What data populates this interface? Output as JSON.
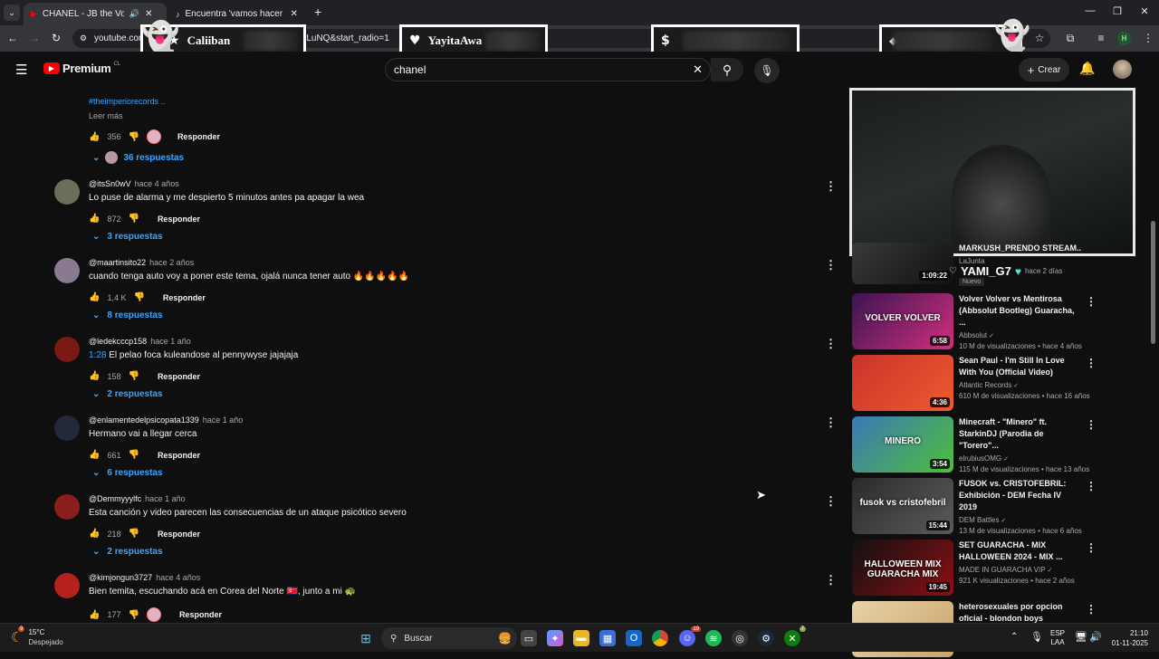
{
  "browser": {
    "tabs": [
      {
        "title": "CHANEL - JB the Voice | Vi"
      },
      {
        "title": "Encuentra 'vamos hacer desma"
      }
    ],
    "new_tab": "+",
    "url_start": "youtube.com",
    "url_end": "rLuNQ&start_radio=1",
    "profile_initial": "H"
  },
  "overlays": [
    {
      "name": "Caliiban",
      "icon": "star-icon"
    },
    {
      "name": "YayitaAwa",
      "icon": "heart-icon"
    },
    {
      "name": "$",
      "icon": "dollar-icon"
    },
    {
      "name": "◆",
      "icon": "diamond-icon"
    }
  ],
  "youtube": {
    "logo": "Premium",
    "logo_region": "CL",
    "search_value": "chanel",
    "create_label": "Crear"
  },
  "top_comment": {
    "hashtag": "#theimperiorecords ..",
    "read_more": "Leer más",
    "likes": "356",
    "reply_label": "Responder",
    "replies": "36 respuestas"
  },
  "comments": [
    {
      "handle": "@itsSn0wV",
      "time": "hace 4 años",
      "text": "Lo puse de alarma y me despierto 5 minutos antes pa apagar la wea",
      "likes": "872",
      "reply": "Responder",
      "replies": "3 respuestas",
      "avatar_color": "#6b6f5a"
    },
    {
      "handle": "@maartinsito22",
      "time": "hace 2 años",
      "text": "cuando tenga auto voy a poner este tema, ojalá nunca tener auto 🔥🔥🔥🔥🔥",
      "likes": "1,4 K",
      "reply": "Responder",
      "replies": "8 respuestas",
      "avatar_color": "#8a7a8f"
    },
    {
      "handle": "@ledekcccp158",
      "time": "hace 1 año",
      "timestamp": "1:28",
      "text": "El pelao foca kuleandose al pennywyse jajajaja",
      "likes": "158",
      "reply": "Responder",
      "replies": "2 respuestas",
      "avatar_color": "#7a1a12"
    },
    {
      "handle": "@enlamentedelpsicopata1339",
      "time": "hace 1 año",
      "text": "Hermano vai a llegar cerca",
      "likes": "661",
      "reply": "Responder",
      "replies": "6 respuestas",
      "avatar_color": "#23283a"
    },
    {
      "handle": "@Demmyyylfc",
      "time": "hace 1 año",
      "text": "Esta canción y video parecen las consecuencias de un ataque psicótico severo",
      "likes": "218",
      "reply": "Responder",
      "replies": "2 respuestas",
      "avatar_color": "#8c1d1d"
    },
    {
      "handle": "@kimjongun3727",
      "time": "hace 4 años",
      "text": "Bien temita, escuchando acá en Corea del Norte 🇰🇵, junto a mi 🐢",
      "likes": "177",
      "reply": "Responder",
      "replies": "",
      "avatar_color": "#b5221c"
    }
  ],
  "stream": {
    "title": "MARKUSH_PRENDO STREAM...",
    "channel": "LaJunta",
    "duration": "1:09:22",
    "badge": "Nuevo",
    "streamer": "YAMI_G7",
    "posted": "hace 2 días"
  },
  "recommendations": [
    {
      "title": "Volver Volver vs Mentirosa (Abbsolut Bootleg) Guaracha, ...",
      "channel": "Abbsolut",
      "views": "10 M de visualizaciones",
      "age": "hace 4 años",
      "duration": "6:58",
      "thumb_text": "VOLVER VOLVER",
      "colors": [
        "#3b1452",
        "#d1307c"
      ]
    },
    {
      "title": "Sean Paul - I'm Still In Love With You (Official Video)",
      "channel": "Atlantic Records",
      "views": "610 M de visualizaciones",
      "age": "hace 16 años",
      "duration": "4:36",
      "thumb_text": "",
      "colors": [
        "#c9342a",
        "#ec5b2f"
      ]
    },
    {
      "title": "Minecraft - \"Minero\" ft. StarkinDJ (Parodia de \"Torero\"...",
      "channel": "elrubiusOMG",
      "views": "115 M de visualizaciones",
      "age": "hace 13 años",
      "duration": "3:54",
      "thumb_text": "MINERO",
      "colors": [
        "#3a78b8",
        "#4fbf3a"
      ]
    },
    {
      "title": "FUSOK vs. CRISTOFEBRIL: Exhibición - DEM Fecha IV 2019",
      "channel": "DEM Battles",
      "views": "13 M de visualizaciones",
      "age": "hace 6 años",
      "duration": "15:44",
      "thumb_text": "fusok vs cristofebril",
      "colors": [
        "#2b2b2b",
        "#5a5a5a"
      ]
    },
    {
      "title": "SET GUARACHA - MIX HALLOWEEN 2024 - MIX ...",
      "channel": "MADE IN GUARACHA VIP",
      "views": "921 K visualizaciones",
      "age": "hace 2 años",
      "duration": "19:45",
      "thumb_text": "HALLOWEEN MIX GUARACHA MIX",
      "colors": [
        "#111",
        "#8c0f14"
      ]
    },
    {
      "title": "heterosexuales por opcion oficial - blondon boys",
      "channel": "",
      "views": "",
      "age": "",
      "duration": "",
      "thumb_text": "",
      "colors": [
        "#e8d3a8",
        "#c9a36b"
      ]
    }
  ],
  "taskbar": {
    "temp": "15°C",
    "weather": "Despejado",
    "search": "Buscar",
    "lang": "ESP",
    "region": "LAA",
    "time": "21:10",
    "date": "01-11-2025",
    "weather_badge": "9",
    "discord_badge": "19",
    "xbox_badge": "7"
  }
}
